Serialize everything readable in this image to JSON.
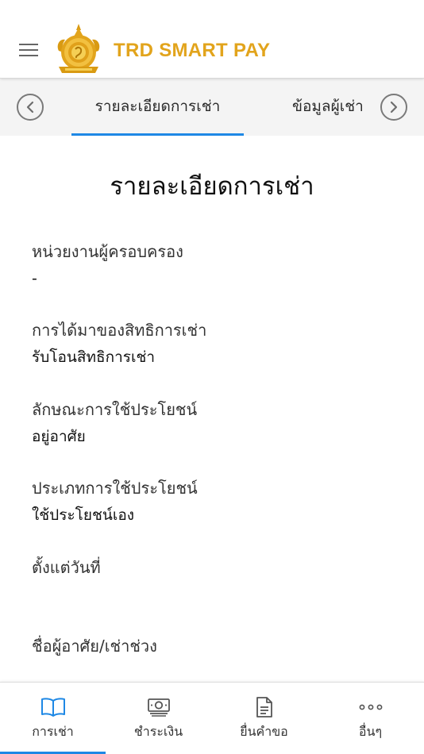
{
  "header": {
    "app_title": "TRD SMART PAY",
    "brand_color": "#E2A41C"
  },
  "tabs": {
    "items": [
      {
        "label": "รายละเอียดการเช่า",
        "active": true
      },
      {
        "label": "ข้อมูลผู้เช่า",
        "active": false
      }
    ],
    "accent_color": "#1E88E5"
  },
  "main": {
    "title": "รายละเอียดการเช่า",
    "fields": [
      {
        "label": "หน่วยงานผู้ครอบครอง",
        "value": "-"
      },
      {
        "label": "การได้มาของสิทธิการเช่า",
        "value": "รับโอนสิทธิการเช่า"
      },
      {
        "label": "ลักษณะการใช้ประโยชน์",
        "value": "อยู่อาศัย"
      },
      {
        "label": "ประเภทการใช้ประโยชน์",
        "value": "ใช้ประโยชน์เอง"
      },
      {
        "label": "ตั้งแต่วันที่",
        "value": ""
      },
      {
        "label": "ชื่อผู้อาศัย/เช่าช่วง",
        "value": ""
      }
    ]
  },
  "bottom_nav": {
    "items": [
      {
        "label": "การเช่า",
        "icon": "book-icon",
        "active": true
      },
      {
        "label": "ชำระเงิน",
        "icon": "banknote-icon",
        "active": false
      },
      {
        "label": "ยื่นคำขอ",
        "icon": "document-icon",
        "active": false
      },
      {
        "label": "อื่นๆ",
        "icon": "more-dots-icon",
        "active": false
      }
    ]
  }
}
